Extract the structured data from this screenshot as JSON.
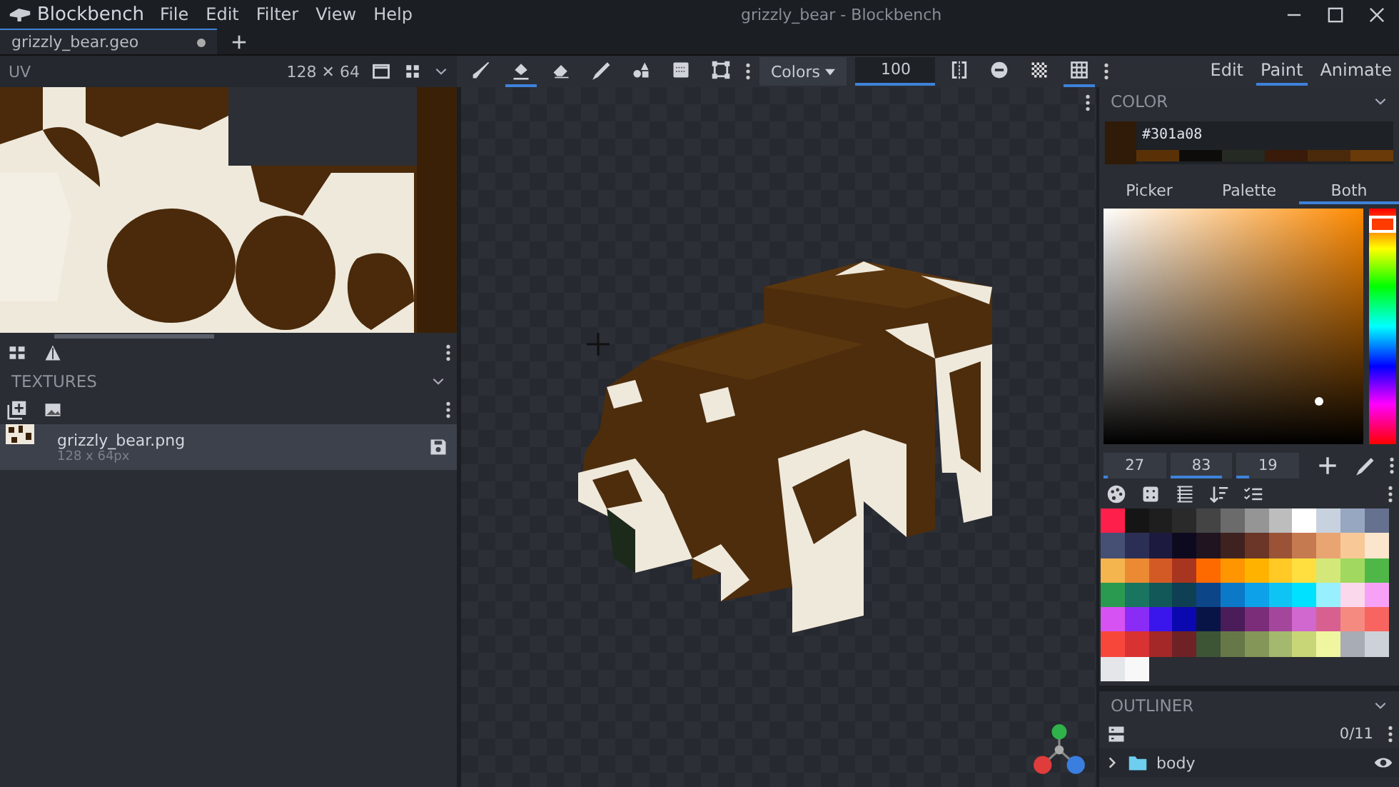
{
  "window": {
    "app_name": "Blockbench",
    "title": "grizzly_bear - Blockbench"
  },
  "menu": [
    "File",
    "Edit",
    "Filter",
    "View",
    "Help"
  ],
  "file_tabs": [
    {
      "label": "grizzly_bear.geo",
      "selected": true,
      "unsaved": true
    }
  ],
  "uv_panel": {
    "title": "UV",
    "size": "128 ✕ 64"
  },
  "toolbar": {
    "tools": [
      {
        "kind": "brush",
        "selected": false
      },
      {
        "kind": "fill",
        "selected": true
      },
      {
        "kind": "eraser",
        "selected": false
      },
      {
        "kind": "picker",
        "selected": false
      },
      {
        "kind": "shapes",
        "selected": false
      },
      {
        "kind": "gradient",
        "selected": false
      },
      {
        "kind": "select",
        "selected": false
      }
    ],
    "color_mode": "Colors",
    "brush_size": "100",
    "options": [
      {
        "kind": "mirror",
        "selected": false
      },
      {
        "kind": "opacity"
      },
      {
        "kind": "checker"
      },
      {
        "kind": "grid",
        "selected": true
      }
    ]
  },
  "modes": [
    {
      "label": "Edit",
      "selected": false
    },
    {
      "label": "Paint",
      "selected": true
    },
    {
      "label": "Animate",
      "selected": false
    }
  ],
  "textures": {
    "title": "TEXTURES",
    "items": [
      {
        "name": "grizzly_bear.png",
        "size": "128 x 64px",
        "selected": true
      }
    ]
  },
  "color": {
    "title": "COLOR",
    "hex": "#301a08",
    "history": [
      {
        "color": "#5a3106"
      },
      {
        "color": "#0d0c0a"
      },
      {
        "color": "#252a22"
      },
      {
        "color": "#3a1a08"
      },
      {
        "color": "#4a2a0a"
      },
      {
        "color": "#6a3a08"
      }
    ],
    "hue": {
      "level": 0.03
    },
    "tabs": [
      {
        "label": "Picker",
        "selected": false
      },
      {
        "label": "Palette",
        "selected": false
      },
      {
        "label": "Both",
        "selected": true
      }
    ],
    "values": [
      {
        "value": "27",
        "level": 0.08
      },
      {
        "value": "83",
        "level": 0.83
      },
      {
        "value": "19",
        "level": 0.19
      }
    ],
    "palette": [
      {
        "color": "#ff1f4b"
      },
      {
        "color": "#151515"
      },
      {
        "color": "#1e1e1e"
      },
      {
        "color": "#2a2a2a"
      },
      {
        "color": "#444444"
      },
      {
        "color": "#6b6b6b"
      },
      {
        "color": "#959595"
      },
      {
        "color": "#bdbdbd"
      },
      {
        "color": "#ffffff"
      },
      {
        "color": "#c8d2de"
      },
      {
        "color": "#97a6c1"
      },
      {
        "color": "#66708f"
      },
      {
        "color": "#455074"
      },
      {
        "color": "#2c2f55"
      },
      {
        "color": "#1c1a3e"
      },
      {
        "color": "#0d0a20"
      },
      {
        "color": "#1f1420"
      },
      {
        "color": "#3e2220"
      },
      {
        "color": "#6b3527"
      },
      {
        "color": "#9a5337"
      },
      {
        "color": "#c67a50"
      },
      {
        "color": "#e9a571"
      },
      {
        "color": "#f8c996"
      },
      {
        "color": "#fbe5cc"
      },
      {
        "color": "#f4b44e"
      },
      {
        "color": "#ec8a33"
      },
      {
        "color": "#d45a25"
      },
      {
        "color": "#a8351f"
      },
      {
        "color": "#ff6a00"
      },
      {
        "color": "#ff9500"
      },
      {
        "color": "#ffb300"
      },
      {
        "color": "#ffc926"
      },
      {
        "color": "#ffdf40"
      },
      {
        "color": "#d4e87a"
      },
      {
        "color": "#a0d860"
      },
      {
        "color": "#4fb748"
      },
      {
        "color": "#2a9a50"
      },
      {
        "color": "#1a7560"
      },
      {
        "color": "#125858"
      },
      {
        "color": "#0f3f52"
      },
      {
        "color": "#0d4589"
      },
      {
        "color": "#0b78c8"
      },
      {
        "color": "#0ca1e8"
      },
      {
        "color": "#0ec4f5"
      },
      {
        "color": "#00e0ff"
      },
      {
        "color": "#98f0ff"
      },
      {
        "color": "#fcd8ec"
      },
      {
        "color": "#f7a1f6"
      },
      {
        "color": "#d652f2"
      },
      {
        "color": "#8a2cf5"
      },
      {
        "color": "#3a16ec"
      },
      {
        "color": "#0c08b0"
      },
      {
        "color": "#081446"
      },
      {
        "color": "#4a1c5a"
      },
      {
        "color": "#7b2d7a"
      },
      {
        "color": "#a4479c"
      },
      {
        "color": "#d068d0"
      },
      {
        "color": "#d86090"
      },
      {
        "color": "#f58a80"
      },
      {
        "color": "#f86460"
      },
      {
        "color": "#f7473b"
      },
      {
        "color": "#d83232"
      },
      {
        "color": "#a52828"
      },
      {
        "color": "#6e2226"
      },
      {
        "color": "#3d5535"
      },
      {
        "color": "#667848"
      },
      {
        "color": "#849658"
      },
      {
        "color": "#a4b86e"
      },
      {
        "color": "#c8d678"
      },
      {
        "color": "#f0f6a0"
      },
      {
        "color": "#a8acb4"
      },
      {
        "color": "#cdd2d8"
      },
      {
        "color": "#e4e6ea"
      },
      {
        "color": "#f8f8f8"
      }
    ]
  },
  "outliner": {
    "title": "OUTLINER",
    "count": "0/11",
    "items": [
      {
        "name": "body",
        "expanded": false,
        "visible": true
      }
    ]
  }
}
